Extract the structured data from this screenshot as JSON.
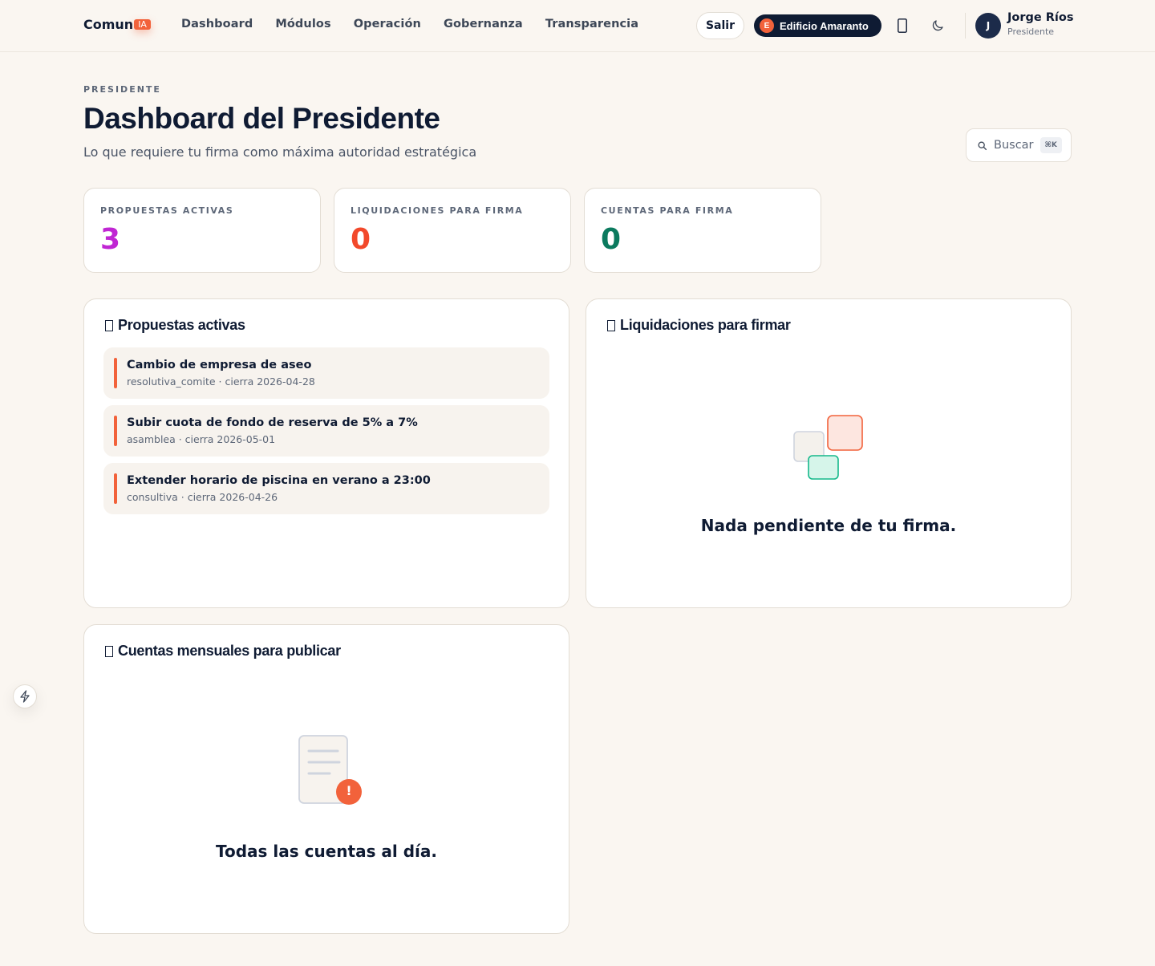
{
  "header": {
    "brand": "Comun",
    "brand_badge": "IA",
    "nav": [
      "Dashboard",
      "Módulos",
      "Operación",
      "Gobernanza",
      "Transparencia"
    ],
    "logout_label": "Salir",
    "building_initial": "E",
    "building_name": "Edificio Amaranto",
    "user_initial": "J",
    "user_name": "Jorge Ríos",
    "user_role": "Presidente"
  },
  "page": {
    "eyebrow": "PRESIDENTE",
    "title": "Dashboard del Presidente",
    "subtitle": "Lo que requiere tu firma como máxima autoridad estratégica",
    "search_label": "Buscar",
    "search_shortcut": "⌘K"
  },
  "stats": [
    {
      "label": "PROPUESTAS ACTIVAS",
      "value": "3",
      "color": "#c026d3"
    },
    {
      "label": "LIQUIDACIONES PARA FIRMA",
      "value": "0",
      "color": "#f2492b"
    },
    {
      "label": "CUENTAS PARA FIRMA",
      "value": "0",
      "color": "#0b7a5e"
    }
  ],
  "proposals_panel": {
    "title": "Propuestas activas",
    "items": [
      {
        "title": "Cambio de empresa de aseo",
        "meta": "resolutiva_comite · cierra 2026-04-28"
      },
      {
        "title": "Subir cuota de fondo de reserva de 5% a 7%",
        "meta": "asamblea · cierra 2026-05-01"
      },
      {
        "title": "Extender horario de piscina en verano a 23:00",
        "meta": "consultiva · cierra 2026-04-26"
      }
    ]
  },
  "settlements_panel": {
    "title": "Liquidaciones para firmar",
    "empty_message": "Nada pendiente de tu firma."
  },
  "accounts_panel": {
    "title": "Cuentas mensuales para publicar",
    "empty_message": "Todas las cuentas al día.",
    "badge": "!"
  },
  "colors": {
    "accent": "#f2623b",
    "navy": "#0f1b33",
    "teal": "#14b88a"
  },
  "icons": [
    "phone-icon",
    "moon-icon",
    "search-icon",
    "bolt-icon",
    "stacked-squares-icon",
    "document-alert-icon"
  ]
}
